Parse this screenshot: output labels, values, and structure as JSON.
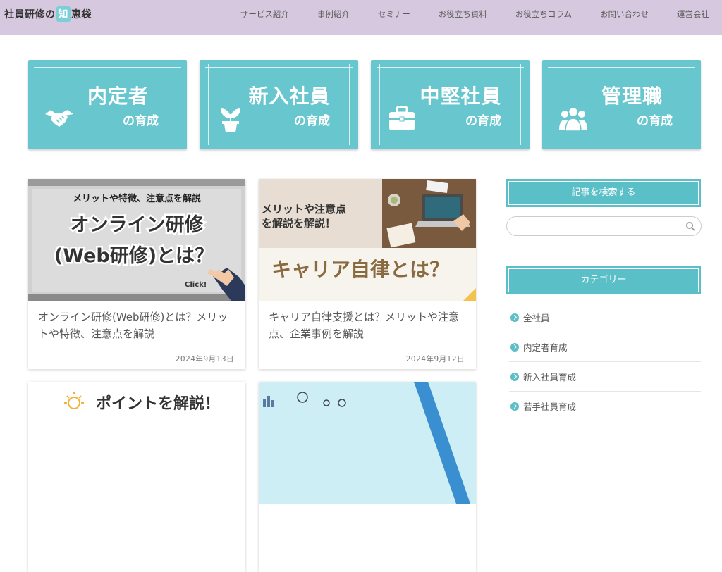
{
  "header": {
    "logo_pre": "社員研修の",
    "logo_chi": "知",
    "logo_post": "恵袋",
    "nav": [
      "サービス紹介",
      "事例紹介",
      "セミナー",
      "お役立ち資料",
      "お役立ちコラム",
      "お問い合わせ",
      "運営会社"
    ]
  },
  "cards": [
    {
      "title": "内定者",
      "sub": "の育成",
      "icon": "handshake-icon"
    },
    {
      "title": "新入社員",
      "sub": "の育成",
      "icon": "sprout-icon"
    },
    {
      "title": "中堅社員",
      "sub": "の育成",
      "icon": "briefcase-icon"
    },
    {
      "title": "管理職",
      "sub": "の育成",
      "icon": "group-icon"
    }
  ],
  "articles": [
    {
      "thumb_top": "メリットや特徴、注意点を解説",
      "thumb_main1": "オンライン研修",
      "thumb_main2": "(Web研修)とは？",
      "thumb_click": "Click!",
      "title": "オンライン研修(Web研修)とは？メリットや特徴、注意点を解説",
      "date": "2024年9月13日"
    },
    {
      "thumb_top1": "メリットや注意点",
      "thumb_top2": "を解説を解説！",
      "thumb_main": "キャリア自律とは？",
      "title": "キャリア自律支援とは？メリットや注意点、企業事例を解説",
      "date": "2024年9月12日"
    },
    {
      "thumb_main": "ポイントを解説！"
    },
    {}
  ],
  "sidebar": {
    "search_heading": "記事を検索する",
    "search_placeholder": "",
    "category_heading": "カテゴリー",
    "categories": [
      "全社員",
      "内定者育成",
      "新入社員育成",
      "若手社員育成"
    ]
  },
  "colors": {
    "header_bg": "#d6c8de",
    "accent": "#67c6ce"
  }
}
